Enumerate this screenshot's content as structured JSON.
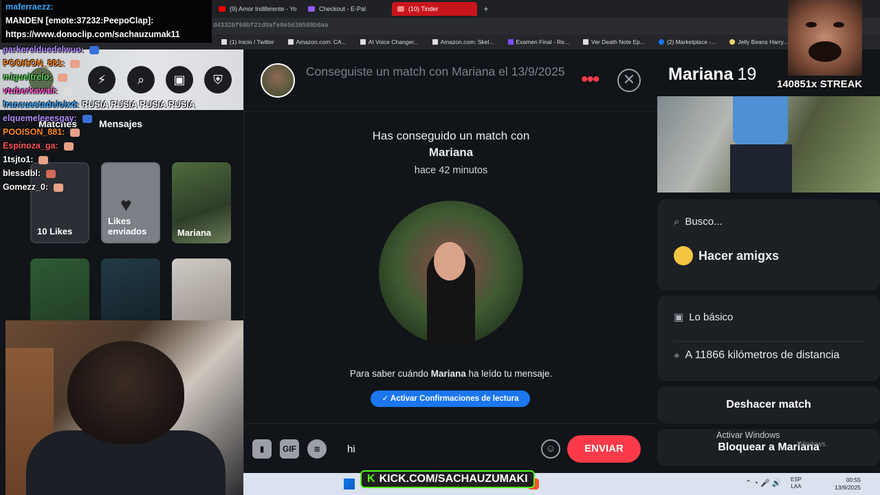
{
  "browser": {
    "tabs": [
      {
        "label": "(9) Amor Indiferente - Yo",
        "icon_color": "#ff0000"
      },
      {
        "label": "Checkout - E-Pal",
        "icon_color": "#8e5cf6"
      },
      {
        "label": "(10) Tinder",
        "icon_color": "#fd3a4a"
      }
    ],
    "new_tab": "+",
    "url_fragment": "d4332bf68bf21d9afe0e5638588b6aa",
    "bookmarks": [
      "(1) Inicio / Twitter",
      "Amazon.com: CA...",
      "AI Voice Changer...",
      "Amazon.com: Skel...",
      "Examen Final - Re...",
      "Ver Death Note Ep...",
      "(2) Marketplace -...",
      "Jelly Beans Harry..."
    ]
  },
  "stream_chat": {
    "lines": [
      {
        "user": "maferraezz:",
        "text": "",
        "color": "#3fa9ff"
      },
      {
        "user": "",
        "text": "MANDEN [emote:37232:PeepoClap]:",
        "color": "#ffffff"
      },
      {
        "user": "",
        "text": "https://www.donoclip.com/sachauzumak11",
        "color": "#ffffff"
      },
      {
        "user": "parkerelduedelwuo:",
        "text": "",
        "color": "#b48cff"
      },
      {
        "user": "POOISON_881:",
        "text": "",
        "color": "#ff8a1f"
      },
      {
        "user": "migueltrelo:",
        "text": "",
        "color": "#5fd35f"
      },
      {
        "user": "vtuberkawaii:",
        "text": "",
        "color": "#ff5bd0"
      },
      {
        "user": "francuestadelolxd:",
        "text": "RUSIA RUSIA RUSIA RUSIA",
        "color": "#3fa9ff"
      },
      {
        "user": "elquemeleeesgay:",
        "text": "",
        "color": "#b48cff"
      },
      {
        "user": "POOISON_881:",
        "text": "",
        "color": "#ff8a1f"
      },
      {
        "user": "Espinoza_ga:",
        "text": "",
        "color": "#ff5555"
      },
      {
        "user": "1tsjto1:",
        "text": "",
        "color": "#ffffff"
      },
      {
        "user": "blessdbl:",
        "text": "",
        "color": "#ffffff"
      },
      {
        "user": "Gomezz_0:",
        "text": "",
        "color": "#ffffff"
      }
    ]
  },
  "sidebar": {
    "tabs": [
      "Matches",
      "Mensajes"
    ],
    "tiles": {
      "likes": "10 Likes",
      "sent": "Likes enviados",
      "mariana": "Mariana"
    }
  },
  "conversation": {
    "header_title": "Conseguiste un match con Mariana el 13/9/2025",
    "match_message_line1": "Has conseguido un match con",
    "match_name": "Mariana",
    "match_time": "hace 42 minutos",
    "read_receipts_pre": "Para saber cuándo ",
    "read_receipts_name": "Mariana",
    "read_receipts_post": " ha leído tu mensaje.",
    "read_receipts_button": "✓ Activar Confirmaciones de lectura",
    "composer": {
      "gif_label": "GIF",
      "input_value": "hi",
      "send_label": "ENVIAR"
    }
  },
  "profile": {
    "name": "Mariana",
    "age": "19",
    "looking_for_label": "Busco...",
    "looking_for_value": "Hacer amigxs",
    "basics_label": "Lo básico",
    "distance": "A 11866 kilómetros de distancia",
    "unmatch": "Deshacer match",
    "block": "Bloquear a Mariana"
  },
  "overlay": {
    "streak": "140851x STREAK",
    "kick": "KICK.COM/SACHAUZUMAKI",
    "kick_logo": "K"
  },
  "windows": {
    "watermark_title": "Activar Windows",
    "watermark_sub": "Windows.",
    "lang1": "ESP",
    "lang2": "LAA",
    "time": "00:55",
    "date": "13/9/2025"
  },
  "colors": {
    "tinder_red": "#fd3a4a",
    "read_blue": "#1b76f0",
    "panel_bg": "#111418",
    "card_bg": "#1c1f24"
  }
}
